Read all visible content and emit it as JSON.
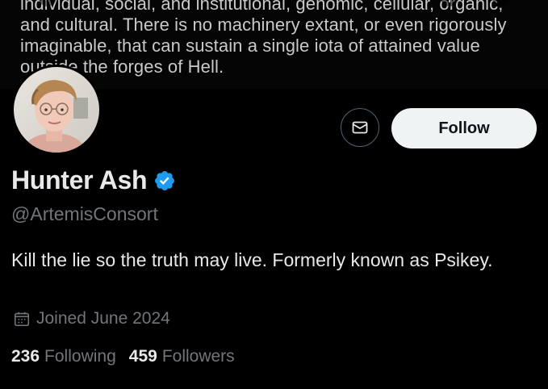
{
  "banner": {
    "text_lines": [
      "individual, social, and institutional, genomic, cellular, organic,",
      "and cultural. There is no machinery extant, or even rigorously",
      "imaginable, that can sustain a single iota of attained value",
      "outside the forges of Hell."
    ],
    "icons": [
      "back-arrow-icon",
      "search-icon",
      "more-icon"
    ]
  },
  "profile": {
    "name": "Hunter Ash",
    "handle": "@ArtemisConsort",
    "verified": true,
    "bio": "Kill the lie so the truth may live. Formerly known as Psikey.",
    "joined": "Joined June 2024",
    "following_count": "236",
    "following_label": "Following",
    "followers_count": "459",
    "followers_label": "Followers"
  },
  "actions": {
    "follow_label": "Follow",
    "message_icon": "envelope-icon"
  },
  "colors": {
    "background": "#000000",
    "primary_text": "#e7e9ea",
    "secondary_text": "#71767b",
    "verified_blue": "#1d9bf0",
    "follow_bg": "#eff3f4"
  }
}
